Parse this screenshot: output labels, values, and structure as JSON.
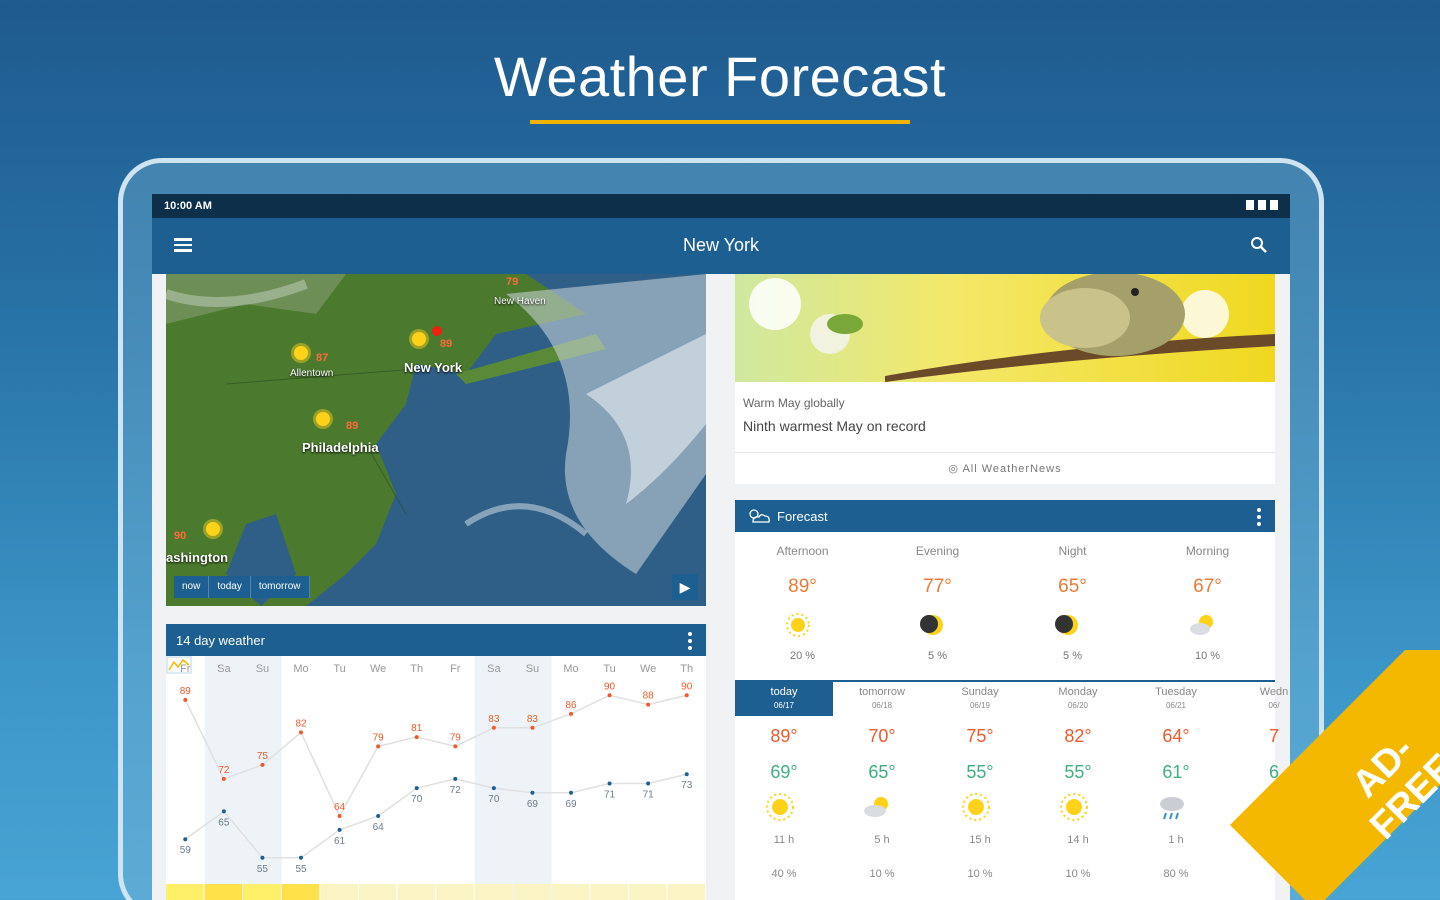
{
  "hero": {
    "title": "Weather Forecast"
  },
  "status": {
    "time": "10:00 AM"
  },
  "appbar": {
    "title": "New York"
  },
  "map": {
    "labels": {
      "new_haven": "New Haven",
      "allentown": "Allentown",
      "new_york": "New York",
      "philadelphia": "Philadelphia",
      "washington": "ashington"
    },
    "temps": {
      "allentown": "87",
      "new_york": "89",
      "philadelphia": "89",
      "washington": "90",
      "top": "79"
    },
    "tabs": [
      "now",
      "today",
      "tomorrow"
    ]
  },
  "news": {
    "kicker": "Warm May globally",
    "headline": "Ninth warmest May on record",
    "link": "All WeatherNews"
  },
  "forecast": {
    "title": "Forecast",
    "dayparts": [
      {
        "label": "Afternoon",
        "temp": "89°",
        "rain": "20 %",
        "icon": "sun-icon"
      },
      {
        "label": "Evening",
        "temp": "77°",
        "rain": "5 %",
        "icon": "moon-icon"
      },
      {
        "label": "Night",
        "temp": "65°",
        "rain": "5 %",
        "icon": "moon-icon"
      },
      {
        "label": "Morning",
        "temp": "67°",
        "rain": "10 %",
        "icon": "partly-cloudy-icon"
      }
    ],
    "days": [
      {
        "name": "today",
        "date": "06/17",
        "hi": "89°",
        "lo": "69°",
        "sun": "11 h",
        "rain": "40 %",
        "icon": "sun-icon"
      },
      {
        "name": "tomorrow",
        "date": "06/18",
        "hi": "70°",
        "lo": "65°",
        "sun": "5 h",
        "rain": "10 %",
        "icon": "partly-cloudy-icon"
      },
      {
        "name": "Sunday",
        "date": "06/19",
        "hi": "75°",
        "lo": "55°",
        "sun": "15 h",
        "rain": "10 %",
        "icon": "sun-icon"
      },
      {
        "name": "Monday",
        "date": "06/20",
        "hi": "82°",
        "lo": "55°",
        "sun": "14 h",
        "rain": "10 %",
        "icon": "sun-icon"
      },
      {
        "name": "Tuesday",
        "date": "06/21",
        "hi": "64°",
        "lo": "61°",
        "sun": "1 h",
        "rain": "80 %",
        "icon": "rain-icon"
      },
      {
        "name": "Wedn",
        "date": "06/",
        "hi": "7",
        "lo": "6",
        "sun": "",
        "rain": "",
        "icon": "rain-icon"
      }
    ]
  },
  "panel14": {
    "title": "14 day weather",
    "days": [
      "Fr",
      "Sa",
      "Su",
      "Mo",
      "Tu",
      "We",
      "Th",
      "Fr",
      "Sa",
      "Su",
      "Mo",
      "Tu",
      "We",
      "Th"
    ],
    "highs": [
      89,
      72,
      75,
      82,
      64,
      79,
      81,
      79,
      83,
      83,
      86,
      90,
      88,
      90
    ],
    "lows": [
      59,
      65,
      55,
      55,
      61,
      64,
      70,
      72,
      70,
      69,
      69,
      71,
      71,
      73
    ]
  },
  "badge": {
    "line1": "AD-",
    "line2": "FREE"
  },
  "colors": {
    "brand": "#1d5f90",
    "accent": "#f5b800",
    "high": "#ee5a2a",
    "low": "#1d5f90"
  }
}
